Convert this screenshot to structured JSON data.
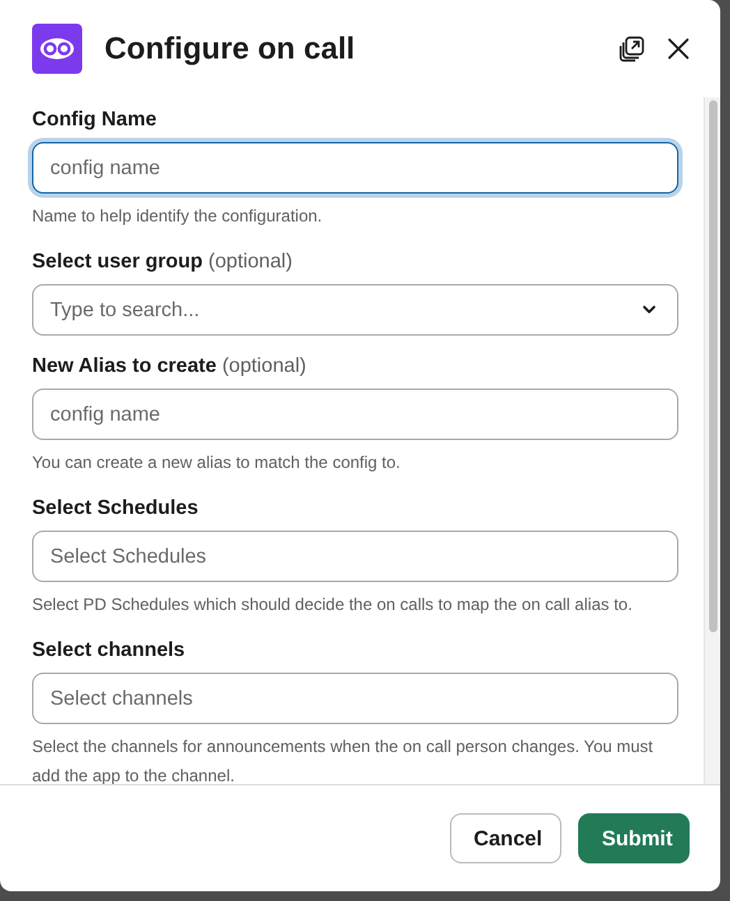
{
  "modal": {
    "title": "Configure on call"
  },
  "fields": [
    {
      "kind": "text",
      "label": "Config Name",
      "placeholder": "config name",
      "focused": true,
      "hint": "Name to help identify the configuration."
    },
    {
      "kind": "select",
      "label": "Select user group",
      "optional_note": "(optional)",
      "placeholder": "Type to search...",
      "focused": false
    },
    {
      "kind": "text",
      "label": "New Alias to create",
      "optional_note": "(optional)",
      "placeholder": "config name",
      "focused": false,
      "hint": "You can create a new alias to match the config to."
    },
    {
      "kind": "text",
      "label": "Select Schedules",
      "placeholder": "Select Schedules",
      "focused": false,
      "hint": "Select PD Schedules which should decide the on calls to map the on call alias to."
    },
    {
      "kind": "text",
      "label": "Select channels",
      "placeholder": "Select channels",
      "focused": false,
      "hint": "Select the channels for announcements when the on call person changes. You must add the app to the channel."
    }
  ],
  "buttons": [
    {
      "kind": "secondary",
      "label": "Cancel"
    },
    {
      "kind": "primary",
      "label": "Submit"
    }
  ]
}
